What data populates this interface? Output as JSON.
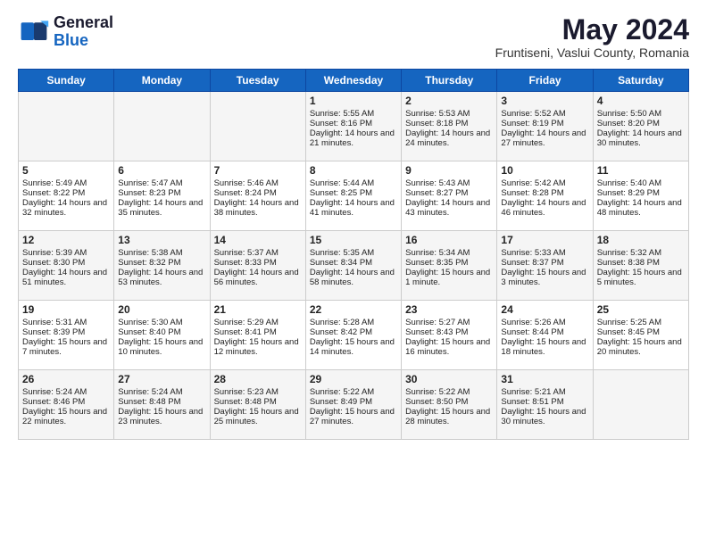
{
  "header": {
    "logo_general": "General",
    "logo_blue": "Blue",
    "month_title": "May 2024",
    "location": "Fruntiseni, Vaslui County, Romania"
  },
  "days_of_week": [
    "Sunday",
    "Monday",
    "Tuesday",
    "Wednesday",
    "Thursday",
    "Friday",
    "Saturday"
  ],
  "weeks": [
    [
      {
        "day": "",
        "info": ""
      },
      {
        "day": "",
        "info": ""
      },
      {
        "day": "",
        "info": ""
      },
      {
        "day": "1",
        "info": "Sunrise: 5:55 AM\nSunset: 8:16 PM\nDaylight: 14 hours and 21 minutes."
      },
      {
        "day": "2",
        "info": "Sunrise: 5:53 AM\nSunset: 8:18 PM\nDaylight: 14 hours and 24 minutes."
      },
      {
        "day": "3",
        "info": "Sunrise: 5:52 AM\nSunset: 8:19 PM\nDaylight: 14 hours and 27 minutes."
      },
      {
        "day": "4",
        "info": "Sunrise: 5:50 AM\nSunset: 8:20 PM\nDaylight: 14 hours and 30 minutes."
      }
    ],
    [
      {
        "day": "5",
        "info": "Sunrise: 5:49 AM\nSunset: 8:22 PM\nDaylight: 14 hours and 32 minutes."
      },
      {
        "day": "6",
        "info": "Sunrise: 5:47 AM\nSunset: 8:23 PM\nDaylight: 14 hours and 35 minutes."
      },
      {
        "day": "7",
        "info": "Sunrise: 5:46 AM\nSunset: 8:24 PM\nDaylight: 14 hours and 38 minutes."
      },
      {
        "day": "8",
        "info": "Sunrise: 5:44 AM\nSunset: 8:25 PM\nDaylight: 14 hours and 41 minutes."
      },
      {
        "day": "9",
        "info": "Sunrise: 5:43 AM\nSunset: 8:27 PM\nDaylight: 14 hours and 43 minutes."
      },
      {
        "day": "10",
        "info": "Sunrise: 5:42 AM\nSunset: 8:28 PM\nDaylight: 14 hours and 46 minutes."
      },
      {
        "day": "11",
        "info": "Sunrise: 5:40 AM\nSunset: 8:29 PM\nDaylight: 14 hours and 48 minutes."
      }
    ],
    [
      {
        "day": "12",
        "info": "Sunrise: 5:39 AM\nSunset: 8:30 PM\nDaylight: 14 hours and 51 minutes."
      },
      {
        "day": "13",
        "info": "Sunrise: 5:38 AM\nSunset: 8:32 PM\nDaylight: 14 hours and 53 minutes."
      },
      {
        "day": "14",
        "info": "Sunrise: 5:37 AM\nSunset: 8:33 PM\nDaylight: 14 hours and 56 minutes."
      },
      {
        "day": "15",
        "info": "Sunrise: 5:35 AM\nSunset: 8:34 PM\nDaylight: 14 hours and 58 minutes."
      },
      {
        "day": "16",
        "info": "Sunrise: 5:34 AM\nSunset: 8:35 PM\nDaylight: 15 hours and 1 minute."
      },
      {
        "day": "17",
        "info": "Sunrise: 5:33 AM\nSunset: 8:37 PM\nDaylight: 15 hours and 3 minutes."
      },
      {
        "day": "18",
        "info": "Sunrise: 5:32 AM\nSunset: 8:38 PM\nDaylight: 15 hours and 5 minutes."
      }
    ],
    [
      {
        "day": "19",
        "info": "Sunrise: 5:31 AM\nSunset: 8:39 PM\nDaylight: 15 hours and 7 minutes."
      },
      {
        "day": "20",
        "info": "Sunrise: 5:30 AM\nSunset: 8:40 PM\nDaylight: 15 hours and 10 minutes."
      },
      {
        "day": "21",
        "info": "Sunrise: 5:29 AM\nSunset: 8:41 PM\nDaylight: 15 hours and 12 minutes."
      },
      {
        "day": "22",
        "info": "Sunrise: 5:28 AM\nSunset: 8:42 PM\nDaylight: 15 hours and 14 minutes."
      },
      {
        "day": "23",
        "info": "Sunrise: 5:27 AM\nSunset: 8:43 PM\nDaylight: 15 hours and 16 minutes."
      },
      {
        "day": "24",
        "info": "Sunrise: 5:26 AM\nSunset: 8:44 PM\nDaylight: 15 hours and 18 minutes."
      },
      {
        "day": "25",
        "info": "Sunrise: 5:25 AM\nSunset: 8:45 PM\nDaylight: 15 hours and 20 minutes."
      }
    ],
    [
      {
        "day": "26",
        "info": "Sunrise: 5:24 AM\nSunset: 8:46 PM\nDaylight: 15 hours and 22 minutes."
      },
      {
        "day": "27",
        "info": "Sunrise: 5:24 AM\nSunset: 8:48 PM\nDaylight: 15 hours and 23 minutes."
      },
      {
        "day": "28",
        "info": "Sunrise: 5:23 AM\nSunset: 8:48 PM\nDaylight: 15 hours and 25 minutes."
      },
      {
        "day": "29",
        "info": "Sunrise: 5:22 AM\nSunset: 8:49 PM\nDaylight: 15 hours and 27 minutes."
      },
      {
        "day": "30",
        "info": "Sunrise: 5:22 AM\nSunset: 8:50 PM\nDaylight: 15 hours and 28 minutes."
      },
      {
        "day": "31",
        "info": "Sunrise: 5:21 AM\nSunset: 8:51 PM\nDaylight: 15 hours and 30 minutes."
      },
      {
        "day": "",
        "info": ""
      }
    ]
  ]
}
